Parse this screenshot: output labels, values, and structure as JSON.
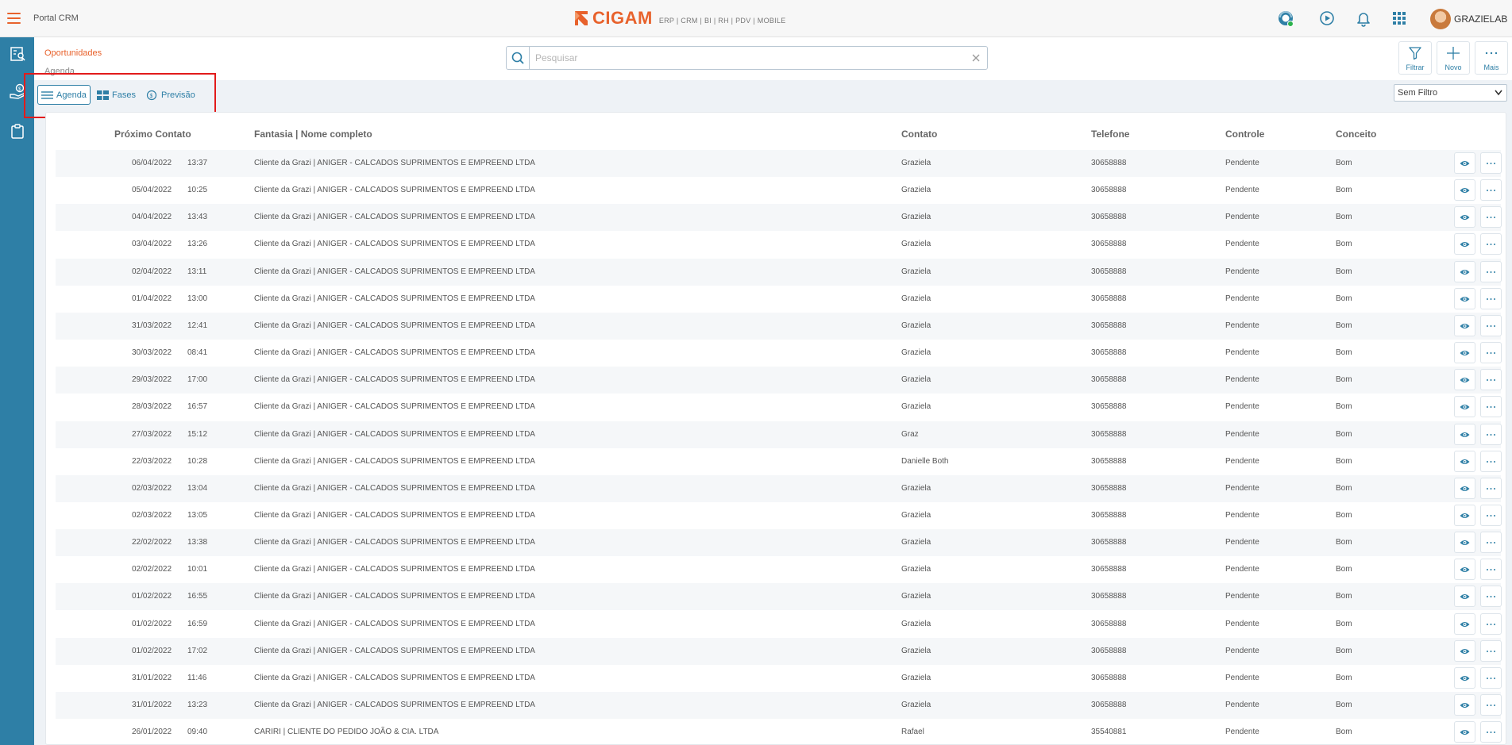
{
  "app": {
    "portal_title": "Portal CRM",
    "logo_text": "CIGAM",
    "logo_subtitle": "ERP | CRM | BI | RH | PDV | MOBILE",
    "user_name": "GRAZIELAB",
    "accent_color": "#e8622c",
    "sidebar_color": "#2e7fa6"
  },
  "topbar_icons": [
    "support-icon",
    "play-icon",
    "bell-icon",
    "apps-grid-icon"
  ],
  "sidebar_icons": [
    "contacts-icon",
    "money-hand-icon",
    "clipboard-icon"
  ],
  "breadcrumb": {
    "section": "Oportunidades",
    "page": "Agenda"
  },
  "search": {
    "placeholder": "Pesquisar",
    "value": ""
  },
  "actions": {
    "filter": "Filtrar",
    "new": "Novo",
    "more": "Mais"
  },
  "views": {
    "agenda": "Agenda",
    "fases": "Fases",
    "previsao": "Previsão",
    "active": "Agenda"
  },
  "filter_select": {
    "selected": "Sem Filtro"
  },
  "table": {
    "headers": {
      "next_contact": "Próximo Contato",
      "name": "Fantasia | Nome completo",
      "contact": "Contato",
      "phone": "Telefone",
      "control": "Controle",
      "concept": "Conceito"
    },
    "rows": [
      {
        "date": "06/04/2022",
        "time": "13:37",
        "name": "Cliente da Grazi | ANIGER - CALCADOS SUPRIMENTOS E EMPREEND LTDA",
        "contact": "Graziela",
        "phone": "30658888",
        "control": "Pendente",
        "concept": "Bom"
      },
      {
        "date": "05/04/2022",
        "time": "10:25",
        "name": "Cliente da Grazi | ANIGER - CALCADOS SUPRIMENTOS E EMPREEND LTDA",
        "contact": "Graziela",
        "phone": "30658888",
        "control": "Pendente",
        "concept": "Bom"
      },
      {
        "date": "04/04/2022",
        "time": "13:43",
        "name": "Cliente da Grazi | ANIGER - CALCADOS SUPRIMENTOS E EMPREEND LTDA",
        "contact": "Graziela",
        "phone": "30658888",
        "control": "Pendente",
        "concept": "Bom"
      },
      {
        "date": "03/04/2022",
        "time": "13:26",
        "name": "Cliente da Grazi | ANIGER - CALCADOS SUPRIMENTOS E EMPREEND LTDA",
        "contact": "Graziela",
        "phone": "30658888",
        "control": "Pendente",
        "concept": "Bom"
      },
      {
        "date": "02/04/2022",
        "time": "13:11",
        "name": "Cliente da Grazi | ANIGER - CALCADOS SUPRIMENTOS E EMPREEND LTDA",
        "contact": "Graziela",
        "phone": "30658888",
        "control": "Pendente",
        "concept": "Bom"
      },
      {
        "date": "01/04/2022",
        "time": "13:00",
        "name": "Cliente da Grazi | ANIGER - CALCADOS SUPRIMENTOS E EMPREEND LTDA",
        "contact": "Graziela",
        "phone": "30658888",
        "control": "Pendente",
        "concept": "Bom"
      },
      {
        "date": "31/03/2022",
        "time": "12:41",
        "name": "Cliente da Grazi | ANIGER - CALCADOS SUPRIMENTOS E EMPREEND LTDA",
        "contact": "Graziela",
        "phone": "30658888",
        "control": "Pendente",
        "concept": "Bom"
      },
      {
        "date": "30/03/2022",
        "time": "08:41",
        "name": "Cliente da Grazi | ANIGER - CALCADOS SUPRIMENTOS E EMPREEND LTDA",
        "contact": "Graziela",
        "phone": "30658888",
        "control": "Pendente",
        "concept": "Bom"
      },
      {
        "date": "29/03/2022",
        "time": "17:00",
        "name": "Cliente da Grazi | ANIGER - CALCADOS SUPRIMENTOS E EMPREEND LTDA",
        "contact": "Graziela",
        "phone": "30658888",
        "control": "Pendente",
        "concept": "Bom"
      },
      {
        "date": "28/03/2022",
        "time": "16:57",
        "name": "Cliente da Grazi | ANIGER - CALCADOS SUPRIMENTOS E EMPREEND LTDA",
        "contact": "Graziela",
        "phone": "30658888",
        "control": "Pendente",
        "concept": "Bom"
      },
      {
        "date": "27/03/2022",
        "time": "15:12",
        "name": "Cliente da Grazi | ANIGER - CALCADOS SUPRIMENTOS E EMPREEND LTDA",
        "contact": "Graz",
        "phone": "30658888",
        "control": "Pendente",
        "concept": "Bom"
      },
      {
        "date": "22/03/2022",
        "time": "10:28",
        "name": "Cliente da Grazi | ANIGER - CALCADOS SUPRIMENTOS E EMPREEND LTDA",
        "contact": "Danielle Both",
        "phone": "30658888",
        "control": "Pendente",
        "concept": "Bom"
      },
      {
        "date": "02/03/2022",
        "time": "13:04",
        "name": "Cliente da Grazi | ANIGER - CALCADOS SUPRIMENTOS E EMPREEND LTDA",
        "contact": "Graziela",
        "phone": "30658888",
        "control": "Pendente",
        "concept": "Bom"
      },
      {
        "date": "02/03/2022",
        "time": "13:05",
        "name": "Cliente da Grazi | ANIGER - CALCADOS SUPRIMENTOS E EMPREEND LTDA",
        "contact": "Graziela",
        "phone": "30658888",
        "control": "Pendente",
        "concept": "Bom"
      },
      {
        "date": "22/02/2022",
        "time": "13:38",
        "name": "Cliente da Grazi | ANIGER - CALCADOS SUPRIMENTOS E EMPREEND LTDA",
        "contact": "Graziela",
        "phone": "30658888",
        "control": "Pendente",
        "concept": "Bom"
      },
      {
        "date": "02/02/2022",
        "time": "10:01",
        "name": "Cliente da Grazi | ANIGER - CALCADOS SUPRIMENTOS E EMPREEND LTDA",
        "contact": "Graziela",
        "phone": "30658888",
        "control": "Pendente",
        "concept": "Bom"
      },
      {
        "date": "01/02/2022",
        "time": "16:55",
        "name": "Cliente da Grazi | ANIGER - CALCADOS SUPRIMENTOS E EMPREEND LTDA",
        "contact": "Graziela",
        "phone": "30658888",
        "control": "Pendente",
        "concept": "Bom"
      },
      {
        "date": "01/02/2022",
        "time": "16:59",
        "name": "Cliente da Grazi | ANIGER - CALCADOS SUPRIMENTOS E EMPREEND LTDA",
        "contact": "Graziela",
        "phone": "30658888",
        "control": "Pendente",
        "concept": "Bom"
      },
      {
        "date": "01/02/2022",
        "time": "17:02",
        "name": "Cliente da Grazi | ANIGER - CALCADOS SUPRIMENTOS E EMPREEND LTDA",
        "contact": "Graziela",
        "phone": "30658888",
        "control": "Pendente",
        "concept": "Bom"
      },
      {
        "date": "31/01/2022",
        "time": "11:46",
        "name": "Cliente da Grazi | ANIGER - CALCADOS SUPRIMENTOS E EMPREEND LTDA",
        "contact": "Graziela",
        "phone": "30658888",
        "control": "Pendente",
        "concept": "Bom"
      },
      {
        "date": "31/01/2022",
        "time": "13:23",
        "name": "Cliente da Grazi | ANIGER - CALCADOS SUPRIMENTOS E EMPREEND LTDA",
        "contact": "Graziela",
        "phone": "30658888",
        "control": "Pendente",
        "concept": "Bom"
      },
      {
        "date": "26/01/2022",
        "time": "09:40",
        "name": "CARIRI | CLIENTE DO PEDIDO JOÃO & CIA. LTDA",
        "contact": "Rafael",
        "phone": "35540881",
        "control": "Pendente",
        "concept": "Bom"
      }
    ]
  }
}
